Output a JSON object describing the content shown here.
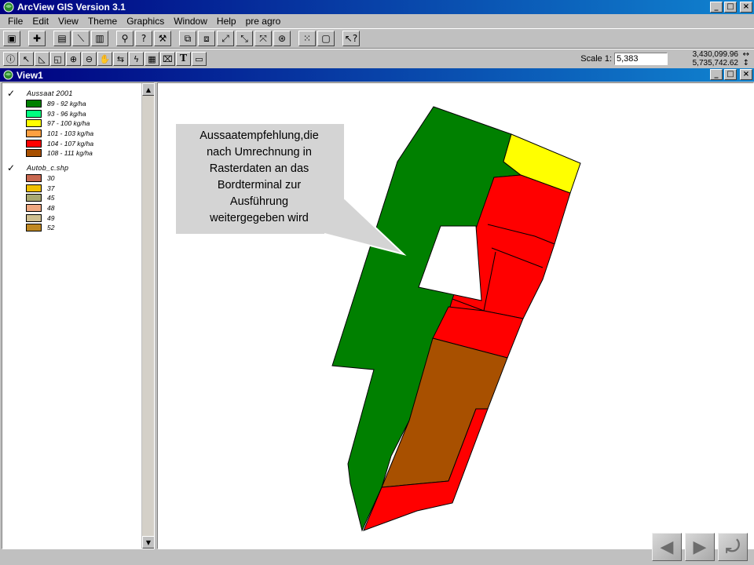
{
  "app": {
    "title": "ArcView GIS Version 3.1",
    "window_buttons": [
      "_",
      "□",
      "×"
    ]
  },
  "menu": [
    "File",
    "Edit",
    "View",
    "Theme",
    "Graphics",
    "Window",
    "Help",
    "pre agro"
  ],
  "toolbar1_icons": [
    "save-icon",
    "add-theme-icon",
    "theme-properties-icon",
    "edit-legend-icon",
    "open-table-icon",
    "find-icon",
    "query-builder-icon",
    "locate-address-icon",
    "zoom-to-extent-icon",
    "zoom-to-themes-icon",
    "zoom-to-selected-icon",
    "zoom-in-icon",
    "zoom-out-icon",
    "zoom-previous-icon",
    "select-features-icon",
    "clear-selection-icon",
    "help-icon"
  ],
  "toolbar2_icons": [
    "identify-icon",
    "pointer-icon",
    "vertex-edit-icon",
    "select-feature-icon",
    "zoom-in-tool-icon",
    "zoom-out-tool-icon",
    "pan-icon",
    "measure-icon",
    "hotlink-icon",
    "area-of-interest-icon",
    "label-icon",
    "text-icon",
    "draw-icon"
  ],
  "scale": {
    "label": "Scale 1:",
    "value": "5,383"
  },
  "coords": {
    "x": "3,430,099.96",
    "y": "5,735,742.62"
  },
  "view": {
    "title": "View1"
  },
  "toc": {
    "themes": [
      {
        "name": "Aussaat 2001",
        "checked": true,
        "classes": [
          {
            "label": "89 - 92 kg/ha",
            "color": "#008000"
          },
          {
            "label": "93 - 96 kg/ha",
            "color": "#00ff80"
          },
          {
            "label": "97 - 100 kg/ha",
            "color": "#ffff00"
          },
          {
            "label": "101 - 103 kg/ha",
            "color": "#ffa040"
          },
          {
            "label": "104 - 107 kg/ha",
            "color": "#ff0000"
          },
          {
            "label": "108 - 111 kg/ha",
            "color": "#a85000"
          }
        ]
      },
      {
        "name": "Autob_c.shp",
        "checked": true,
        "classes": [
          {
            "label": "30",
            "color": "#c86850"
          },
          {
            "label": "37",
            "color": "#f0c000"
          },
          {
            "label": "45",
            "color": "#a8a870"
          },
          {
            "label": "48",
            "color": "#f0a880"
          },
          {
            "label": "49",
            "color": "#d0c090"
          },
          {
            "label": "52",
            "color": "#c08820"
          }
        ]
      }
    ]
  },
  "map_colors": {
    "green": "#008000",
    "yellow": "#ffff00",
    "red": "#ff0000",
    "brown": "#a85000"
  },
  "callout": {
    "lines": [
      "Aussaatempfehlung,die",
      "nach Umrechnung in",
      "Rasterdaten an das",
      "Bordterminal zur",
      "Ausführung",
      "weitergegeben wird"
    ]
  },
  "nav": [
    "back-icon",
    "forward-icon",
    "return-icon"
  ]
}
